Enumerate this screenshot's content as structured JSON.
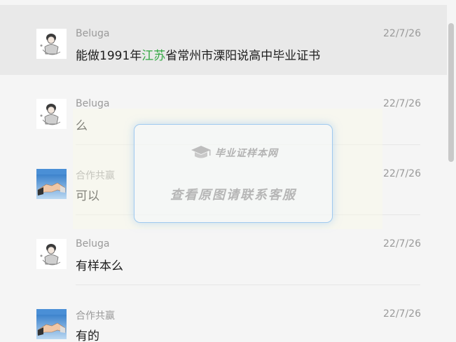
{
  "messages": [
    {
      "sender": "Beluga",
      "time": "22/7/26",
      "text_parts": [
        "能做1991年",
        "江苏",
        "省常州市溧阳说高中毕业证书"
      ],
      "avatar": "cartoon-girl-avatar"
    },
    {
      "sender": "Beluga",
      "time": "22/7/26",
      "text": "么",
      "avatar": "cartoon-girl-avatar"
    },
    {
      "sender": "合作共赢",
      "time": "22/7/26",
      "text": "可以",
      "avatar": "handshake-avatar"
    },
    {
      "sender": "Beluga",
      "time": "22/7/26",
      "text": "有样本么",
      "avatar": "cartoon-girl-avatar"
    },
    {
      "sender": "合作共赢",
      "time": "22/7/26",
      "text": "有的",
      "avatar": "handshake-avatar"
    }
  ],
  "watermark": {
    "brand": "毕业证样本网",
    "text": "查看原图请联系客服"
  },
  "colors": {
    "background": "#f5f5f5",
    "selected_row": "#e9e9e9",
    "highlight": "#35a845",
    "meta_text": "#9a9a9a",
    "watermark_border": "#9fc9ef"
  }
}
